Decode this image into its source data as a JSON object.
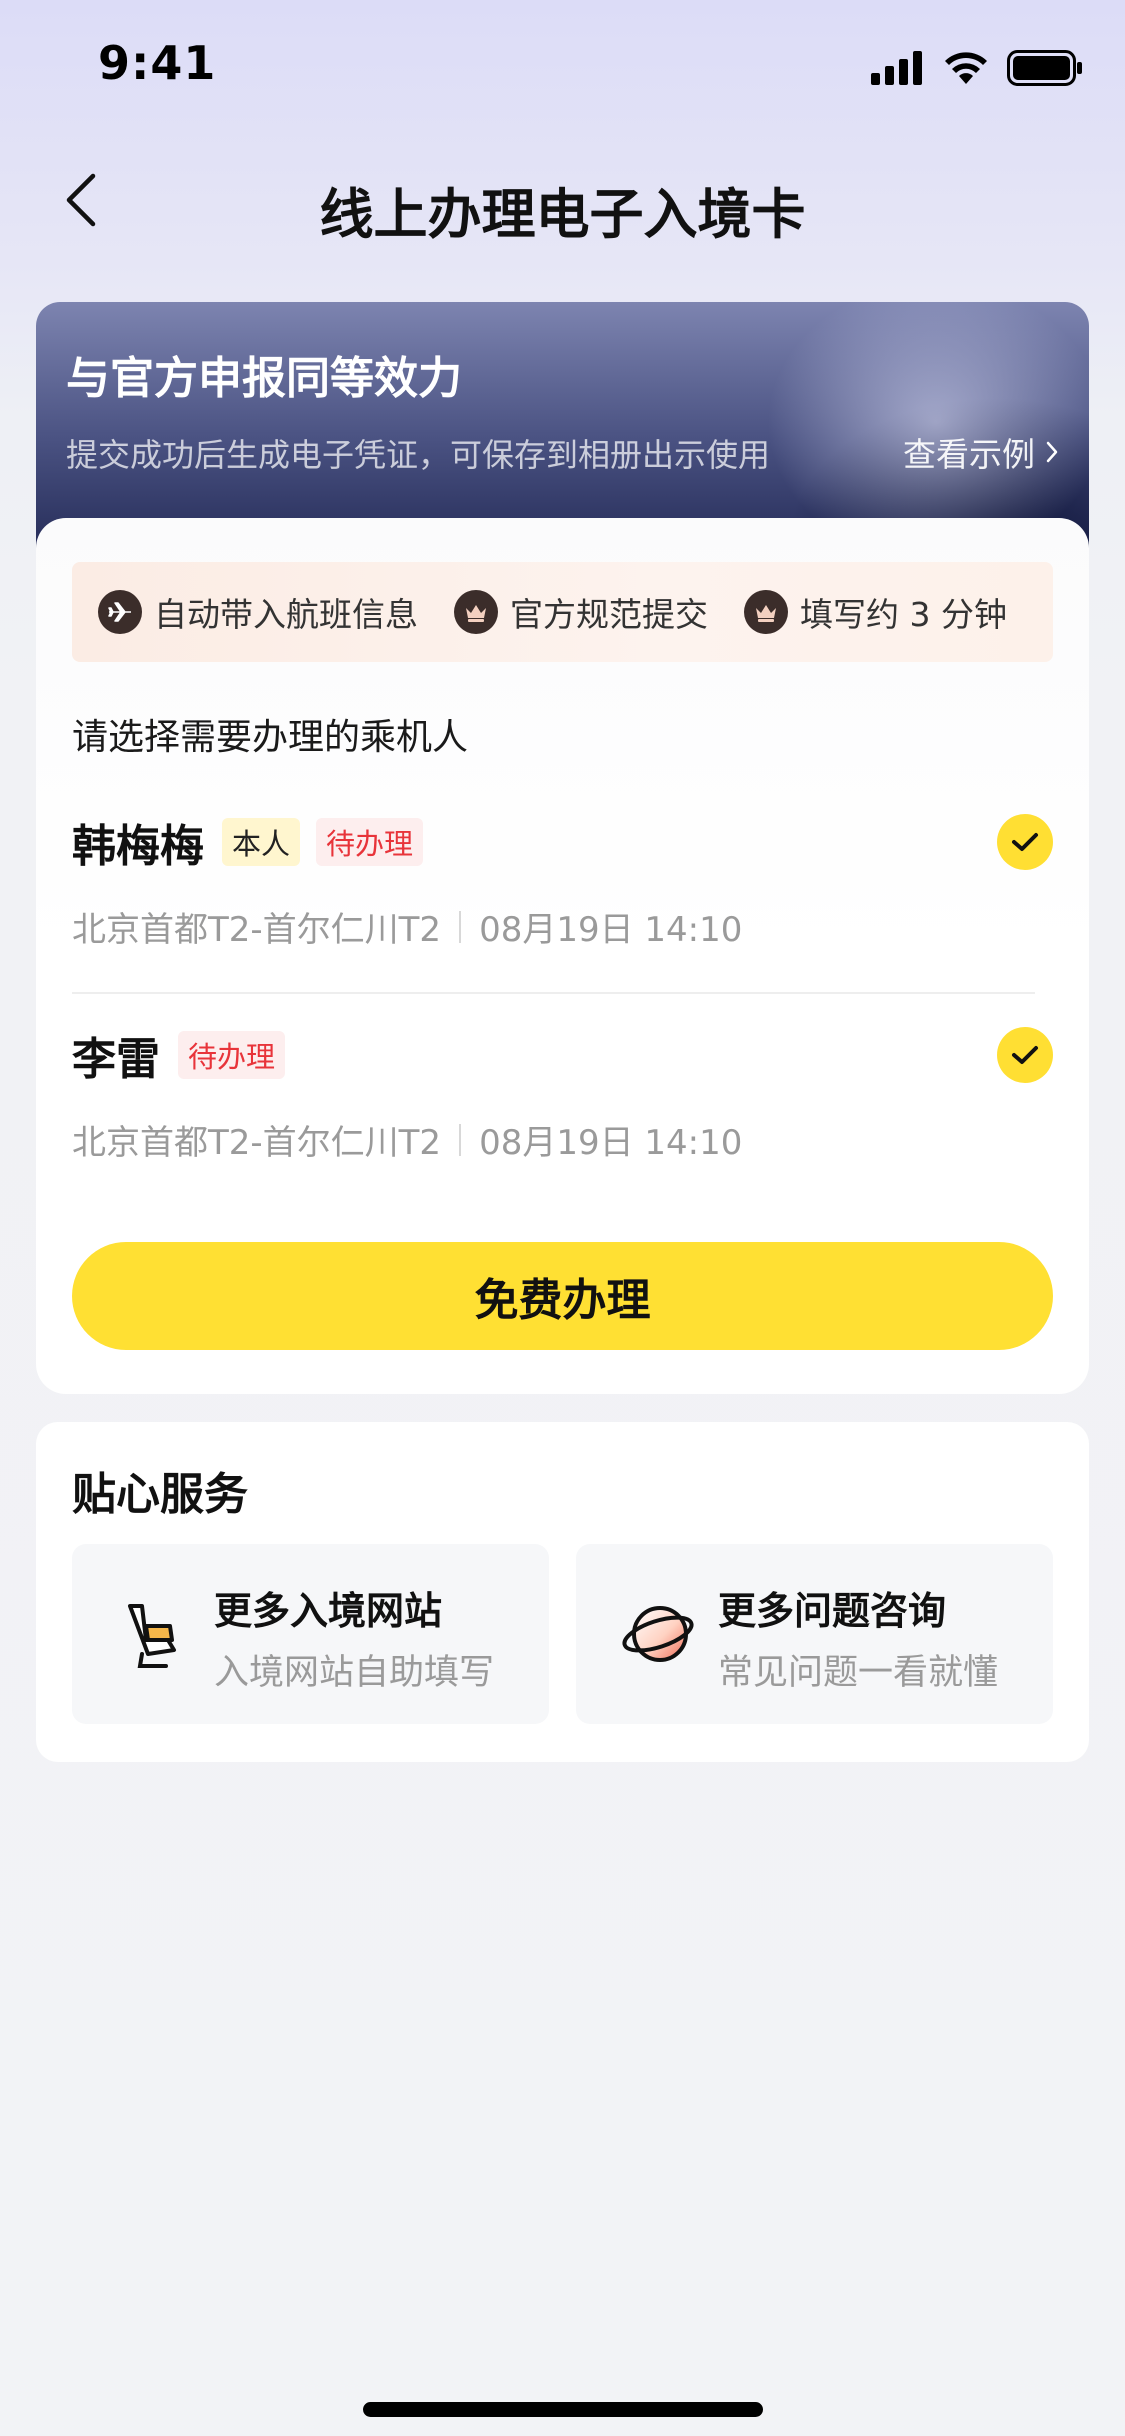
{
  "status_bar": {
    "time": "9:41"
  },
  "nav": {
    "title": "线上办理电子入境卡"
  },
  "banner": {
    "title": "与官方申报同等效力",
    "subtitle": "提交成功后生成电子凭证，可保存到相册出示使用",
    "link_label": "查看示例"
  },
  "features": [
    {
      "icon": "plane-icon",
      "label": "自动带入航班信息"
    },
    {
      "icon": "crown-icon",
      "label": "官方规范提交"
    },
    {
      "icon": "crown-icon",
      "label": "填写约 3 分钟"
    }
  ],
  "passenger_section_label": "请选择需要办理的乘机人",
  "passengers": [
    {
      "name": "韩梅梅",
      "self_tag": "本人",
      "status_tag": "待办理",
      "route": "北京首都T2-首尔仁川T2",
      "datetime": "08月19日 14:10",
      "selected": true
    },
    {
      "name": "李雷",
      "status_tag": "待办理",
      "route": "北京首都T2-首尔仁川T2",
      "datetime": "08月19日 14:10",
      "selected": true
    }
  ],
  "cta_label": "免费办理",
  "services": {
    "title": "贴心服务",
    "items": [
      {
        "icon": "seat-icon",
        "title": "更多入境网站",
        "subtitle": "入境网站自助填写"
      },
      {
        "icon": "planet-icon",
        "title": "更多问题咨询",
        "subtitle": "常见问题一看就懂"
      }
    ]
  },
  "colors": {
    "accent_yellow": "#ffe033",
    "pending_red": "#e8343a",
    "banner_dark": "#252c58"
  }
}
